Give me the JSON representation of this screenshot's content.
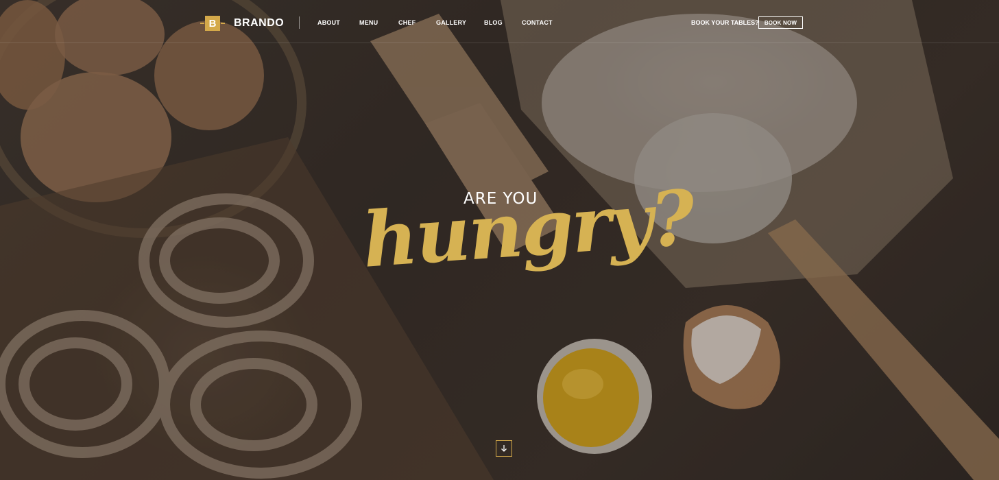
{
  "header": {
    "logo_letter": "B",
    "logo_text": "BRANDO",
    "nav": [
      "ABOUT",
      "MENU",
      "CHEF",
      "GALLERY",
      "BLOG",
      "CONTACT"
    ],
    "book_question": "BOOK YOUR TABLES?",
    "book_button": "BOOK NOW"
  },
  "hero": {
    "tagline_small": "ARE YOU",
    "tagline_big": "hungry?",
    "scroll_icon": "arrow-down-icon"
  },
  "colors": {
    "accent": "#d4a94a",
    "tagline": "#d6b253",
    "background": "#3a3029"
  }
}
